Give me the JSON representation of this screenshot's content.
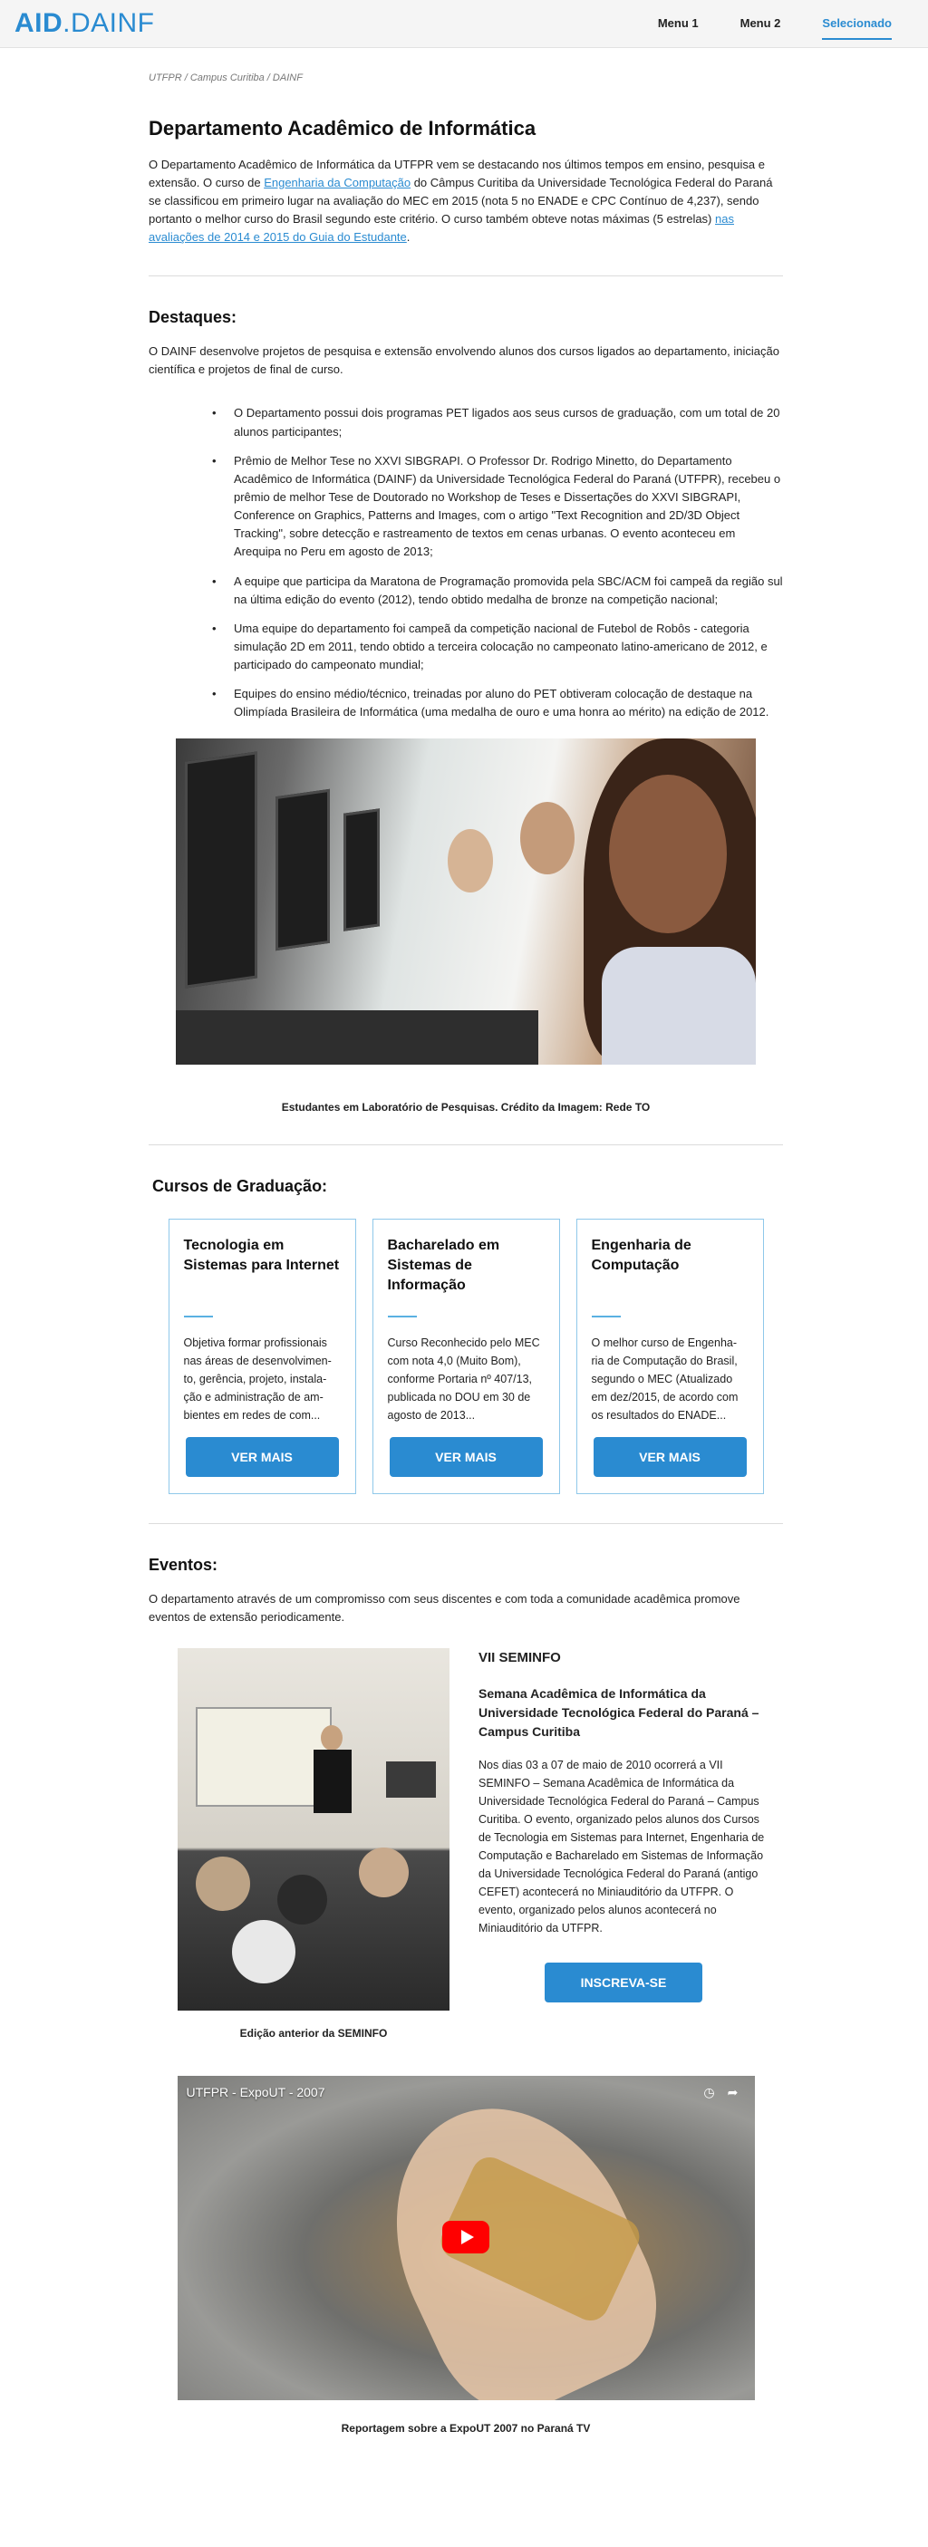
{
  "nav": {
    "logo_bold": "AID",
    "logo_light": ".DAINF",
    "menu": [
      "Menu 1",
      "Menu 2",
      "Selecionado"
    ]
  },
  "breadcrumb": "UTFPR / Campus Curitiba / DAINF",
  "intro": {
    "title": "Departamento Acadêmico de Informática",
    "text_1": "O Departamento Acadêmico de Informática da UTFPR  vem se destacando nos últimos tempos  em ensino, pesquisa e extensão. O curso de ",
    "link_1": "Engenharia da Computação",
    "text_2": " do Câmpus Curitiba da Universidade Tecnológica Federal do Paraná se classificou em primeiro lugar na avaliação do MEC em 2015 (nota 5 no ENADE e CPC Contínuo de 4,237), sendo portanto o melhor curso do Brasil segundo este critério. O curso também obteve notas máximas (5 estrelas) ",
    "link_2": "nas avaliações de 2014 e 2015 do Guia do Estudante",
    "text_3": "."
  },
  "highlights": {
    "title": "Destaques:",
    "text": "O DAINF desenvolve projetos de pesquisa e extensão envolvendo alunos dos cursos ligados ao departamento, iniciação científica e projetos de final de curso.",
    "items": [
      "O Departamento possui dois programas PET ligados aos seus cursos de graduação, com um total de 20 alunos participantes;",
      "Prêmio de Melhor Tese no XXVI SIBGRAPI. O Professor Dr. Rodrigo Minetto, do Departamento Acadêmico de Informática (DAINF) da Universidade Tecnológica Federal do Paraná (UTFPR), recebeu o prêmio de melhor Tese de Doutorado no Workshop de Teses e Dissertações do XXVI SIBGRAPI, Conference on Graphics, Patterns and Images, com o artigo \"Text Recognition and 2D/3D Object Tracking\", sobre detecção e rastreamento de textos em cenas urbanas. O evento aconteceu em Arequipa no Peru em agosto de 2013;",
      "A equipe que participa da Maratona de Programação promovida pela SBC/ACM foi campeã da região sul na última edição do evento (2012), tendo obtido medalha de bronze na competição nacional;",
      "Uma equipe do departamento foi campeã  da competição nacional de Futebol de Robôs - categoria simulação 2D em 2011, tendo obtido a terceira colocação no campeonato latino-americano de 2012, e participado do campeonato mundial;",
      "Equipes  do ensino médio/técnico, treinadas por aluno do PET obtiveram colocação de destaque na Olimpíada Brasileira de Informática (uma medalha de ouro e uma honra ao mérito) na edição de 2012."
    ],
    "caption": "Estudantes em Laboratório de Pesquisas. Crédito da Imagem: Rede TO"
  },
  "courses": {
    "title": "Cursos de Graduação:",
    "button_label": "VER MAIS",
    "items": [
      {
        "name": "Tecnologia em Sistemas para Internet",
        "desc": "Objetiva formar profissionais nas áreas de desenvolvimen-to, gerência, projeto, instala-ção e administração de am-bientes em redes de com..."
      },
      {
        "name": "Bacharelado em Sistemas de Informação",
        "desc": "Curso Reconhecido pelo MEC com nota 4,0 (Muito Bom), conforme Portaria nº 407/13, publicada no DOU em 30 de agosto de 2013..."
      },
      {
        "name": "Engenharia de Computação",
        "desc": "O melhor curso de Engenha-ria de Computação do Brasil, segundo o MEC (Atualizado em dez/2015, de acordo com os resultados do ENADE..."
      }
    ]
  },
  "events": {
    "title": "Eventos:",
    "text": "O departamento através de um compromisso com seus discentes e com toda a comunidade acadêmica promove eventos de extensão periodicamente.",
    "event_name": "VII SEMINFO",
    "event_subtitle": "Semana Acadêmica de Informática da Universidade Tecnológica Federal do Paraná – Campus Curitiba",
    "event_text": "Nos dias 03 a 07 de maio de 2010 ocorrerá a VII SEMINFO – Semana Acadêmica de Informática da Universidade Tecnológica Federal do Paraná – Campus Curitiba. O evento, organizado pelos alunos dos Cursos de Tecnologia em Sistemas para Internet, Engenharia de Computação e Bacharelado em Sistemas de Informação da Universidade Tecnológica Federal do Paraná (antigo CEFET) acontecerá no Miniauditório da UTFPR. O evento, organizado pelos alunos acontecerá no Miniauditório da UTFPR.",
    "button_label": "INSCREVA-SE",
    "photo_caption": "Edição anterior da SEMINFO"
  },
  "video": {
    "title": "UTFPR - ExpoUT - 2007",
    "caption": "Reportagem sobre a ExpoUT 2007 no Paraná TV"
  },
  "colors": {
    "accent": "#2a8bd1",
    "card_border": "#8fc8ea"
  }
}
